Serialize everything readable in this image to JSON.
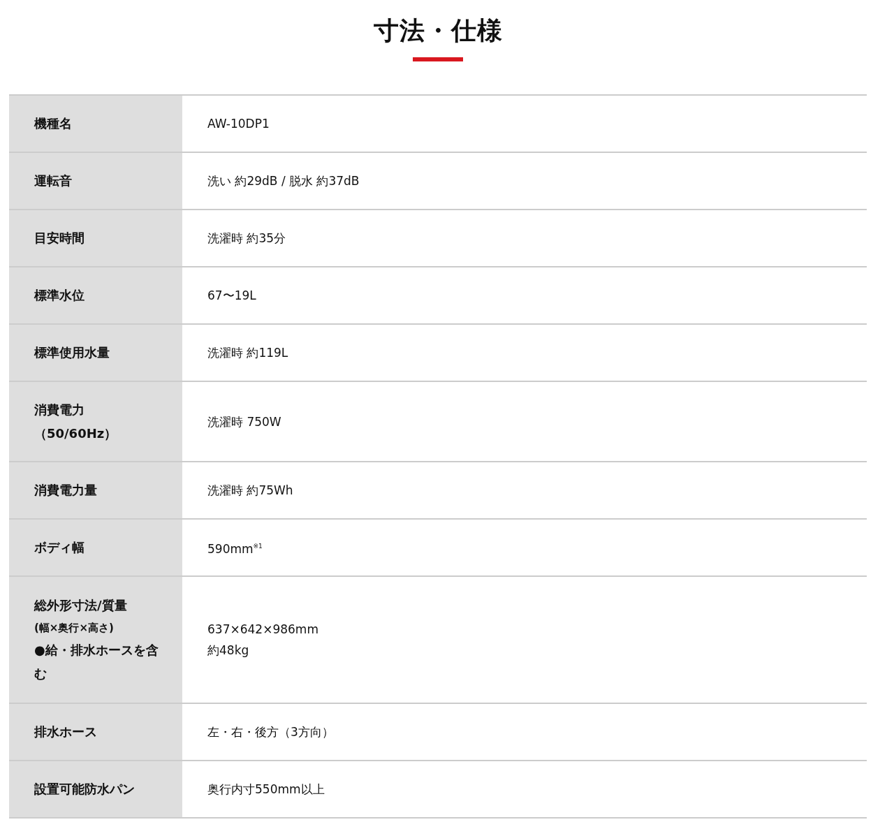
{
  "title": "寸法・仕様",
  "rows": [
    {
      "label": [
        {
          "text": "機種名",
          "kind": "main"
        }
      ],
      "value": [
        "AW-10DP1"
      ]
    },
    {
      "label": [
        {
          "text": "運転音",
          "kind": "main"
        }
      ],
      "value": [
        "洗い 約29dB / 脱水 約37dB"
      ]
    },
    {
      "label": [
        {
          "text": "目安時間",
          "kind": "main"
        }
      ],
      "value": [
        "洗濯時 約35分"
      ]
    },
    {
      "label": [
        {
          "text": "標準水位",
          "kind": "main"
        }
      ],
      "value": [
        "67〜19L"
      ]
    },
    {
      "label": [
        {
          "text": "標準使用水量",
          "kind": "main"
        }
      ],
      "value": [
        "洗濯時 約119L"
      ]
    },
    {
      "label": [
        {
          "text": "消費電力",
          "kind": "main"
        },
        {
          "text": "（50/60Hz）",
          "kind": "main"
        }
      ],
      "value": [
        "洗濯時 750W"
      ]
    },
    {
      "label": [
        {
          "text": "消費電力量",
          "kind": "main"
        }
      ],
      "value": [
        "洗濯時 約75Wh"
      ]
    },
    {
      "label": [
        {
          "text": "ボディ幅",
          "kind": "main"
        }
      ],
      "value": [
        "590mm$^{※1}$"
      ]
    },
    {
      "label": [
        {
          "text": "総外形寸法/質量",
          "kind": "main"
        },
        {
          "text": "(幅×奥行×高さ)",
          "kind": "note"
        },
        {
          "text": "●給・排水ホースを含む",
          "kind": "main"
        }
      ],
      "value": [
        "637×642×986mm",
        "約48kg"
      ]
    },
    {
      "label": [
        {
          "text": "排水ホース",
          "kind": "main"
        }
      ],
      "value": [
        "左・右・後方（3方向）"
      ]
    },
    {
      "label": [
        {
          "text": "設置可能防水パン",
          "kind": "main"
        }
      ],
      "value": [
        "奥行内寸550mm以上"
      ]
    }
  ]
}
